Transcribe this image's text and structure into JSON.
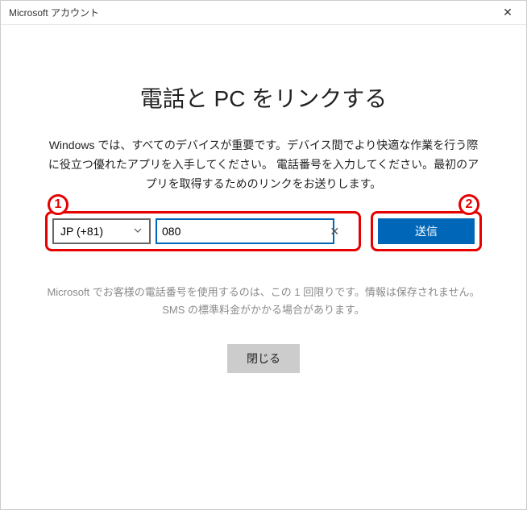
{
  "titlebar": {
    "title": "Microsoft アカウント"
  },
  "page": {
    "heading": "電話と PC をリンクする",
    "description": "Windows では、すべてのデバイスが重要です。デバイス間でより快適な作業を行う際に役立つ優れたアプリを入手してください。 電話番号を入力してください。最初のアプリを取得するためのリンクをお送りします。",
    "note": "Microsoft でお客様の電話番号を使用するのは、この 1 回限りです。情報は保存されません。SMS の標準料金がかかる場合があります。"
  },
  "form": {
    "country_code": "JP (+81)",
    "phone_prefix": "080",
    "send_label": "送信",
    "close_label": "閉じる"
  },
  "annotations": {
    "step1": "1",
    "step2": "2"
  }
}
